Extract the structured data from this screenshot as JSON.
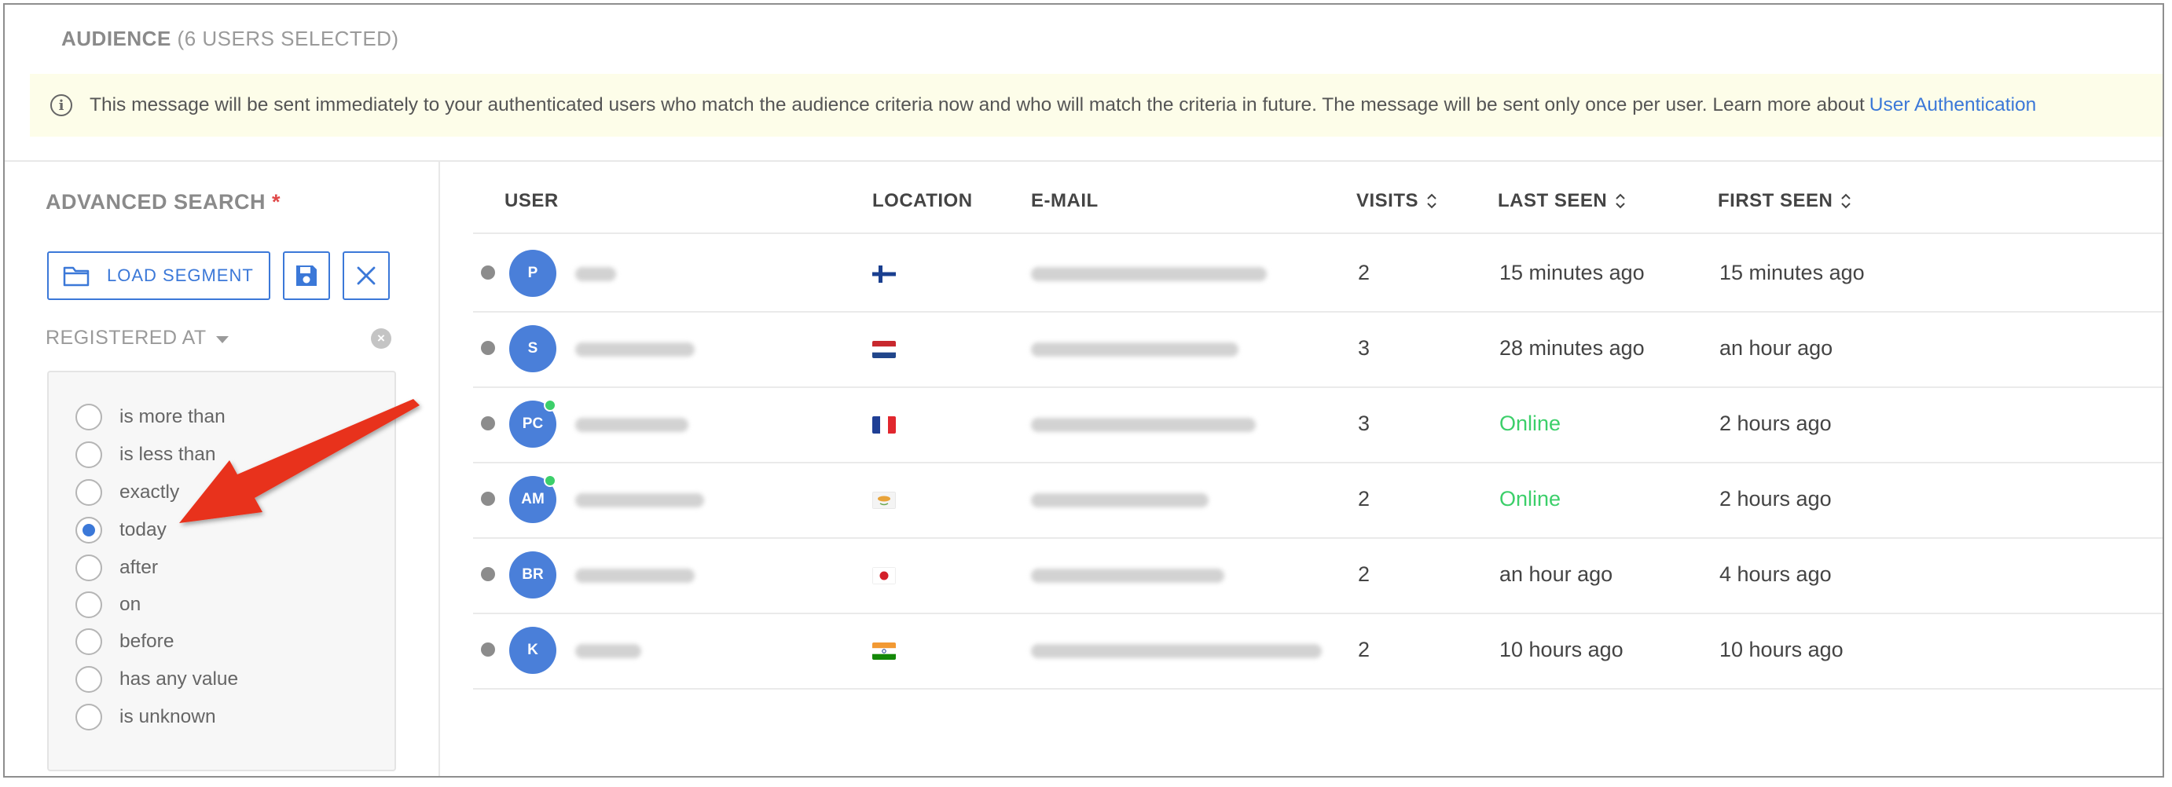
{
  "audience": {
    "title": "AUDIENCE",
    "count": "(6 USERS SELECTED)"
  },
  "notice": {
    "text": "This message will be sent immediately to your authenticated users who match the audience criteria now and who will match the criteria in future. The message will be sent only once per user. Learn more about",
    "link": "User Authentication"
  },
  "advanced_search": {
    "title": "ADVANCED SEARCH",
    "required_mark": "*",
    "load_segment": "LOAD SEGMENT",
    "filter_label": "REGISTERED AT",
    "options": [
      {
        "label": "is more than",
        "checked": false
      },
      {
        "label": "is less than",
        "checked": false
      },
      {
        "label": "exactly",
        "checked": false
      },
      {
        "label": "today",
        "checked": true
      },
      {
        "label": "after",
        "checked": false
      },
      {
        "label": "on",
        "checked": false
      },
      {
        "label": "before",
        "checked": false
      },
      {
        "label": "has any value",
        "checked": false
      },
      {
        "label": "is unknown",
        "checked": false
      }
    ]
  },
  "table": {
    "headers": {
      "user": "USER",
      "location": "LOCATION",
      "email": "E-MAIL",
      "visits": "VISITS",
      "last_seen": "LAST SEEN",
      "first_seen": "FIRST SEEN"
    },
    "rows": [
      {
        "initials": "P",
        "online": false,
        "visits": "2",
        "last_seen": "15 minutes ago",
        "first_seen": "15 minutes ago",
        "flag": "finland"
      },
      {
        "initials": "S",
        "online": false,
        "visits": "3",
        "last_seen": "28 minutes ago",
        "first_seen": "an hour ago",
        "flag": "netherlands"
      },
      {
        "initials": "PC",
        "online": true,
        "visits": "3",
        "last_seen": "Online",
        "first_seen": "2 hours ago",
        "flag": "france"
      },
      {
        "initials": "AM",
        "online": true,
        "visits": "2",
        "last_seen": "Online",
        "first_seen": "2 hours ago",
        "flag": "cyprus"
      },
      {
        "initials": "BR",
        "online": false,
        "visits": "2",
        "last_seen": "an hour ago",
        "first_seen": "4 hours ago",
        "flag": "japan"
      },
      {
        "initials": "K",
        "online": false,
        "visits": "2",
        "last_seen": "10 hours ago",
        "first_seen": "10 hours ago",
        "flag": "india"
      }
    ]
  },
  "colors": {
    "accent": "#3b78d8",
    "online": "#3ccf6a",
    "notice_bg": "#fdfde9",
    "arrow": "#e8321f"
  }
}
